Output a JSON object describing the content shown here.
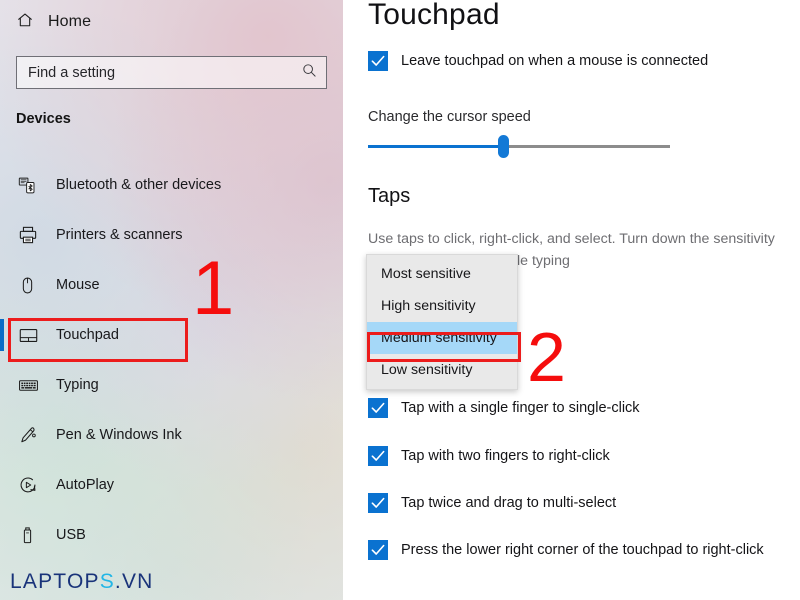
{
  "sidebar": {
    "home": {
      "label": "Home",
      "icon": "home-icon"
    },
    "search": {
      "placeholder": "Find a setting",
      "icon": "search-icon"
    },
    "section_title": "Devices",
    "items": [
      {
        "label": "Bluetooth & other devices",
        "icon": "bluetooth-device-icon",
        "selected": false
      },
      {
        "label": "Printers & scanners",
        "icon": "printer-icon",
        "selected": false
      },
      {
        "label": "Mouse",
        "icon": "mouse-icon",
        "selected": false
      },
      {
        "label": "Touchpad",
        "icon": "touchpad-icon",
        "selected": true
      },
      {
        "label": "Typing",
        "icon": "keyboard-icon",
        "selected": false
      },
      {
        "label": "Pen & Windows Ink",
        "icon": "pen-icon",
        "selected": false
      },
      {
        "label": "AutoPlay",
        "icon": "autoplay-icon",
        "selected": false
      },
      {
        "label": "USB",
        "icon": "usb-icon",
        "selected": false
      }
    ],
    "watermark": {
      "prefix": "LAPTOP",
      "accent": "S",
      "suffix": ".VN"
    }
  },
  "main": {
    "title": "Touchpad",
    "leave_on_checkbox": {
      "label": "Leave touchpad on when a mouse is connected",
      "checked": true
    },
    "cursor_speed_label": "Change the cursor speed",
    "cursor_speed_percent": 45,
    "taps": {
      "group_title": "Taps",
      "description": "Use taps to click, right-click, and select. Turn down the sensitivity\nif your cursor jumps while typing",
      "dropdown": {
        "selected": "Medium sensitivity",
        "options": [
          "Most sensitive",
          "High sensitivity",
          "Medium sensitivity",
          "Low sensitivity"
        ]
      },
      "checkboxes": [
        {
          "label": "Tap with a single finger to single-click",
          "checked": true
        },
        {
          "label": "Tap with two fingers to right-click",
          "checked": true
        },
        {
          "label": "Tap twice and drag to multi-select",
          "checked": true
        },
        {
          "label": "Press the lower right corner of the touchpad to right-click",
          "checked": true
        }
      ]
    }
  },
  "annotations": {
    "step_one": "1",
    "step_two": "2",
    "color": "#f50d0d"
  },
  "colors": {
    "accent_blue": "#0a72d0",
    "highlight_blue": "#a5d8f8",
    "annotation_red": "#ec1c1c",
    "selected_bar": "#0a6cc6"
  }
}
